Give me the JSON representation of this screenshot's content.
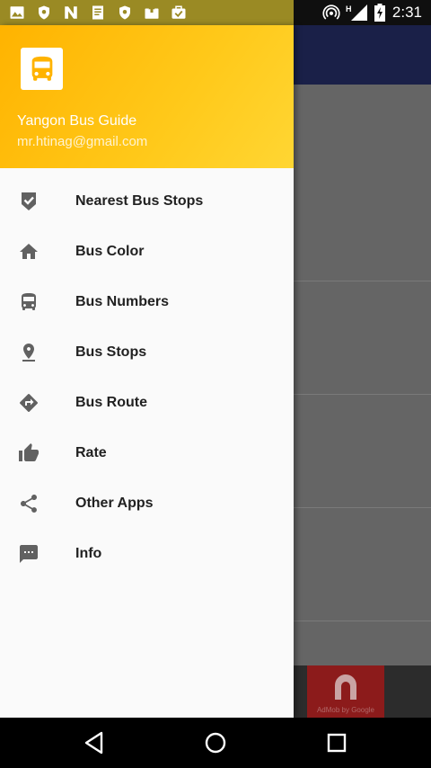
{
  "status_bar": {
    "time": "2:31",
    "network_type": "H",
    "left_icons": [
      "image-icon",
      "shield-icon",
      "n-app-icon",
      "notepad-icon",
      "shield-icon",
      "photo-upload-icon",
      "briefcase-check-icon"
    ],
    "right_icons": [
      "hotspot-icon",
      "signal-icon",
      "battery-charging-icon"
    ]
  },
  "drawer": {
    "header": {
      "app_name": "Yangon Bus Guide",
      "email": "mr.htinag@gmail.com",
      "logo_icon": "bus-icon"
    },
    "items": [
      {
        "label": "Nearest Bus Stops",
        "icon": "shield-check-icon"
      },
      {
        "label": "Bus Color",
        "icon": "home-icon"
      },
      {
        "label": "Bus Numbers",
        "icon": "bus-icon"
      },
      {
        "label": "Bus Stops",
        "icon": "pin-drop-icon"
      },
      {
        "label": "Bus Route",
        "icon": "directions-icon"
      },
      {
        "label": "Rate",
        "icon": "thumb-up-icon"
      },
      {
        "label": "Other Apps",
        "icon": "share-icon"
      },
      {
        "label": "Info",
        "icon": "message-icon"
      }
    ]
  },
  "background_ad": {
    "caption": "AdMob by Google"
  },
  "nav_bar": {
    "buttons": [
      "back-icon",
      "home-circle-icon",
      "recents-icon"
    ]
  },
  "colors": {
    "header_accent": "#ffb300",
    "toolbar": "#1a2048",
    "menu_text": "#212121",
    "menu_icon": "#616161"
  }
}
